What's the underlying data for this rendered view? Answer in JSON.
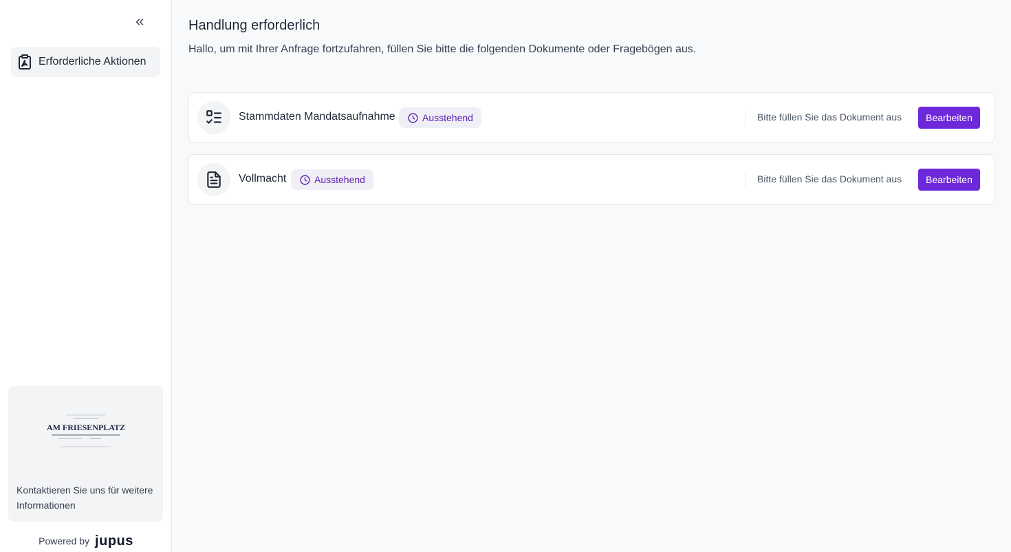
{
  "sidebar": {
    "nav_items": [
      {
        "label": "Erforderliche Aktionen",
        "icon": "clipboard-signature-icon"
      }
    ],
    "contact": {
      "logo_text": "AM FRIESENPLATZ",
      "text": "Kontaktieren Sie uns für weitere Informationen"
    },
    "powered_by": {
      "label": "Powered by",
      "brand": "jupus"
    }
  },
  "main": {
    "title": "Handlung erforderlich",
    "subtitle": "Hallo, um mit Ihrer Anfrage fortzufahren, füllen Sie bitte die folgenden Dokumente oder Fragebögen aus.",
    "items": [
      {
        "icon": "checklist-icon",
        "title": "Stammdaten Mandatsaufnahme",
        "status": "Ausstehend",
        "hint": "Bitte füllen Sie das Dokument aus",
        "action": "Bearbeiten"
      },
      {
        "icon": "document-icon",
        "title": "Vollmacht",
        "status": "Ausstehend",
        "hint": "Bitte füllen Sie das Dokument aus",
        "action": "Bearbeiten"
      }
    ]
  },
  "colors": {
    "accent": "#6d28d9",
    "badge_bg": "#f1eff6",
    "badge_text": "#5b21b6"
  }
}
